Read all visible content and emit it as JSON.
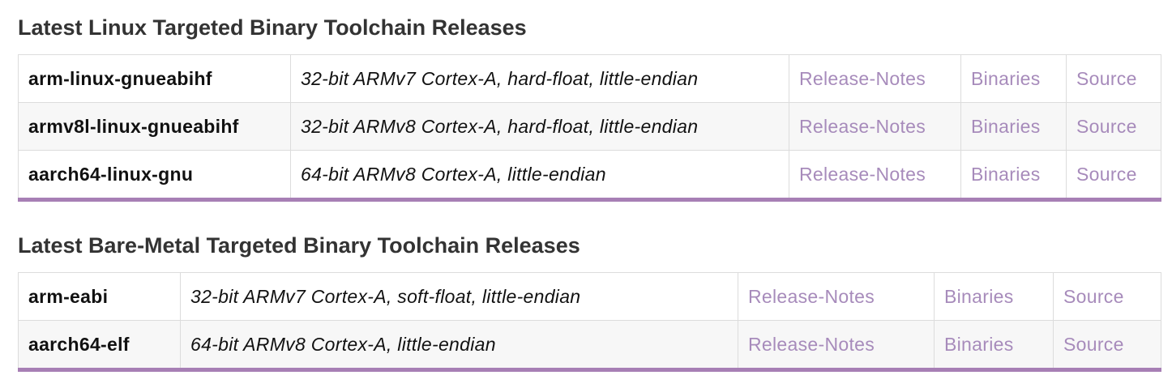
{
  "sections": [
    {
      "title": "Latest Linux Targeted Binary Toolchain Releases",
      "rows": [
        {
          "name": "arm-linux-gnueabihf",
          "desc": "32-bit ARMv7 Cortex-A, hard-float, little-endian",
          "release_notes": "Release-Notes",
          "binaries": "Binaries",
          "source": "Source"
        },
        {
          "name": "armv8l-linux-gnueabihf",
          "desc": "32-bit ARMv8 Cortex-A, hard-float, little-endian",
          "release_notes": "Release-Notes",
          "binaries": "Binaries",
          "source": "Source"
        },
        {
          "name": "aarch64-linux-gnu",
          "desc": "64-bit ARMv8 Cortex-A, little-endian",
          "release_notes": "Release-Notes",
          "binaries": "Binaries",
          "source": "Source"
        }
      ]
    },
    {
      "title": "Latest Bare-Metal Targeted Binary Toolchain Releases",
      "rows": [
        {
          "name": "arm-eabi",
          "desc": "32-bit ARMv7 Cortex-A, soft-float, little-endian",
          "release_notes": "Release-Notes",
          "binaries": "Binaries",
          "source": "Source"
        },
        {
          "name": "aarch64-elf",
          "desc": "64-bit ARMv8 Cortex-A, little-endian",
          "release_notes": "Release-Notes",
          "binaries": "Binaries",
          "source": "Source"
        }
      ]
    }
  ],
  "colors": {
    "link": "#a78bbb",
    "accent_border": "#a77fb5",
    "heading": "#333333",
    "row_alt_bg": "#f7f7f7"
  }
}
